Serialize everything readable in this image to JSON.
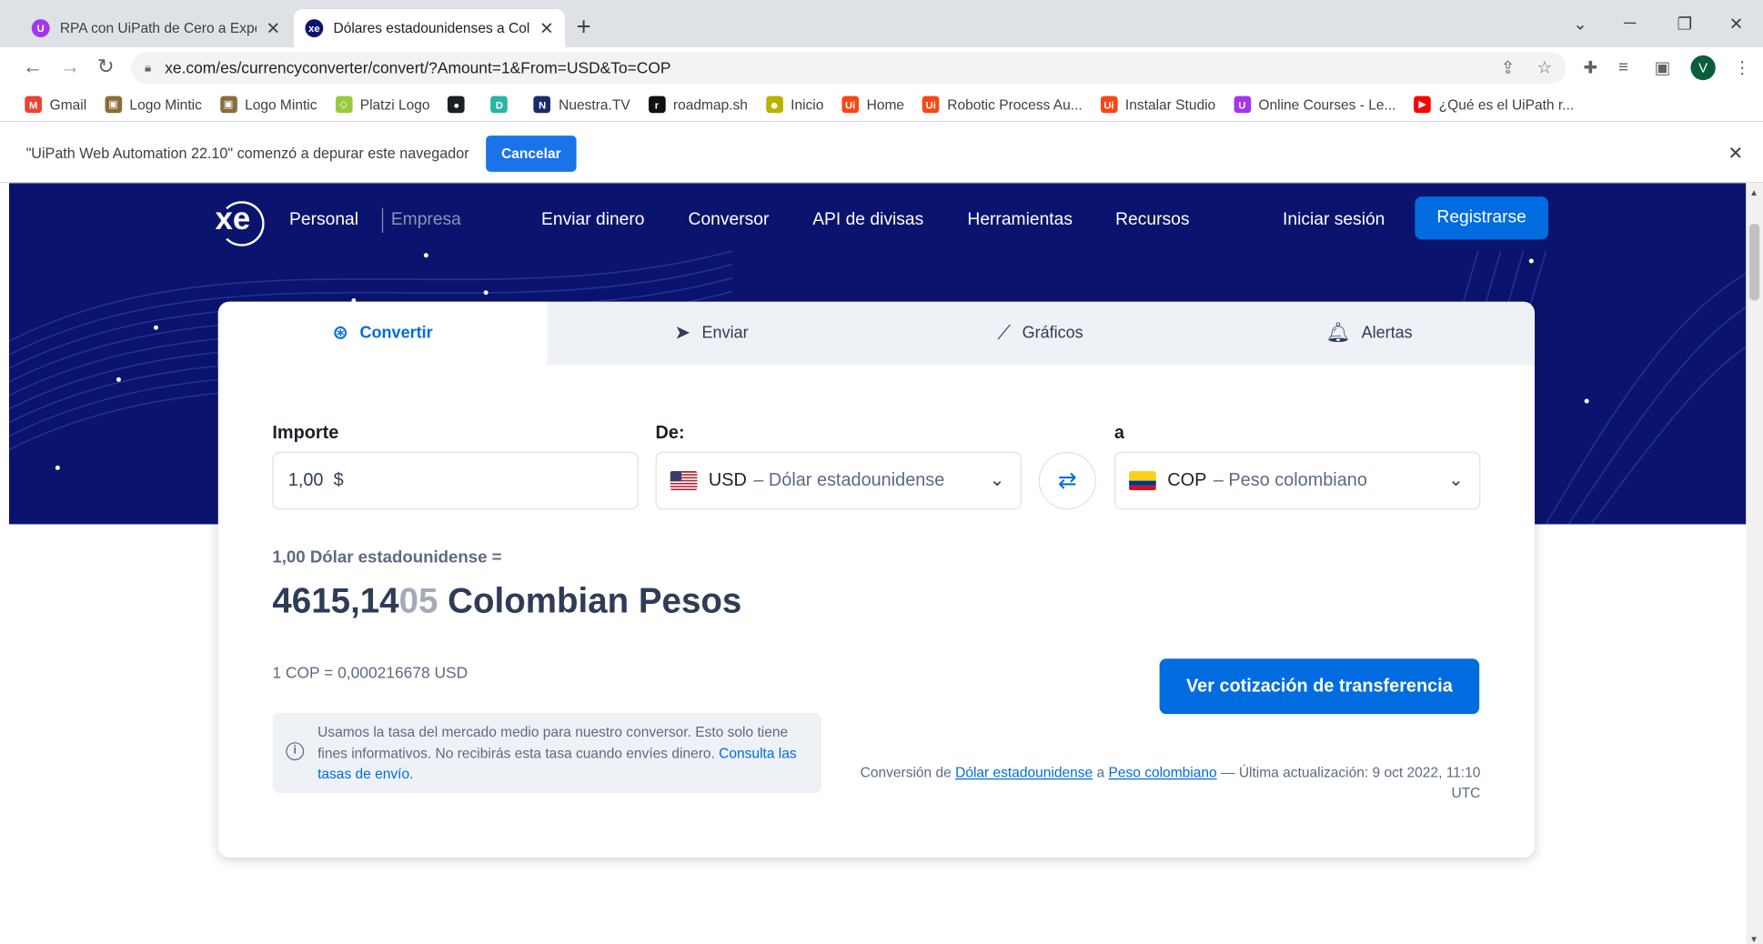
{
  "browser": {
    "tabs": [
      {
        "title": "RPA con UiPath de Cero a Experto",
        "icon": "udemy-icon",
        "color": "#a435f0"
      },
      {
        "title": "Dólares estadounidenses a Colon",
        "icon": "xe-icon",
        "color": "#0a146e"
      }
    ],
    "url": "xe.com/es/currencyconverter/convert/?Amount=1&From=USD&To=COP",
    "avatar": "V",
    "bookmarks": [
      {
        "label": "Gmail",
        "icon": "gmail-icon",
        "color": "#ea4335",
        "glyph": "M"
      },
      {
        "label": "Logo Mintic",
        "icon": "mintic-icon",
        "color": "#8a6d3b",
        "glyph": "▣"
      },
      {
        "label": "Logo Mintic",
        "icon": "mintic-icon",
        "color": "#8a6d3b",
        "glyph": "▣"
      },
      {
        "label": "Platzi Logo",
        "icon": "platzi-icon",
        "color": "#98ca3f",
        "glyph": "◇"
      },
      {
        "label": "",
        "icon": "github-icon",
        "color": "#1b1f23",
        "glyph": "●"
      },
      {
        "label": "",
        "icon": "bookmark-d-icon",
        "color": "#2bb3a3",
        "glyph": "D"
      },
      {
        "label": "Nuestra.TV",
        "icon": "nuestra-tv-icon",
        "color": "#1c2a6b",
        "glyph": "N"
      },
      {
        "label": "roadmap.sh",
        "icon": "roadmap-icon",
        "color": "#111111",
        "glyph": "r"
      },
      {
        "label": "Inicio",
        "icon": "inicio-icon",
        "color": "#b7b200",
        "glyph": "☻"
      },
      {
        "label": "Home",
        "icon": "uipath-icon",
        "color": "#fa4616",
        "glyph": "Ui"
      },
      {
        "label": "Robotic Process Au...",
        "icon": "uipath-icon",
        "color": "#fa4616",
        "glyph": "Ui"
      },
      {
        "label": "Instalar Studio",
        "icon": "uipath-icon",
        "color": "#fa4616",
        "glyph": "Ui"
      },
      {
        "label": "Online Courses - Le...",
        "icon": "udemy-icon",
        "color": "#a435f0",
        "glyph": "U"
      },
      {
        "label": "¿Qué es el UiPath r...",
        "icon": "youtube-icon",
        "color": "#ff0000",
        "glyph": "▶"
      }
    ],
    "infobar": {
      "message": "\"UiPath Web Automation 22.10\" comenzó a depurar este navegador",
      "cancel_label": "Cancelar"
    }
  },
  "site": {
    "nav": {
      "personal": "Personal",
      "empresa": "Empresa",
      "items": [
        "Enviar dinero",
        "Conversor",
        "API de divisas",
        "Herramientas",
        "Recursos"
      ],
      "login": "Iniciar sesión",
      "register": "Registrarse"
    },
    "card_tabs": [
      {
        "label": "Convertir",
        "icon": "convert-coins-icon",
        "active": true
      },
      {
        "label": "Enviar",
        "icon": "send-plane-icon",
        "active": false
      },
      {
        "label": "Gráficos",
        "icon": "chart-line-icon",
        "active": false
      },
      {
        "label": "Alertas",
        "icon": "bell-icon",
        "active": false
      }
    ],
    "converter": {
      "amount_label": "Importe",
      "amount_value": "1,00",
      "amount_symbol": "$",
      "from_label": "De:",
      "from_code": "USD",
      "from_name": "– Dólar estadounidense",
      "to_label": "a",
      "to_code": "COP",
      "to_name": "– Peso colombiano",
      "result_from": "1,00 Dólar estadounidense =",
      "result_main": "4615,14",
      "result_faded": "05",
      "result_currency": "Colombian Pesos",
      "inverse_rate": "1 COP = 0,000216678 USD",
      "transfer_button": "Ver cotización de transferencia",
      "note_text": "Usamos la tasa del mercado medio para nuestro conversor. Esto solo tiene fines informativos. No recibirás esta tasa cuando envíes dinero.",
      "note_link": "Consulta las tasas de envío.",
      "update_prefix": "Conversión de",
      "update_link_from": "Dólar estadounidense",
      "update_mid": "a",
      "update_link_to": "Peso colombiano",
      "update_suffix": "— Última actualización: 9 oct 2022, 11:10 UTC"
    }
  }
}
